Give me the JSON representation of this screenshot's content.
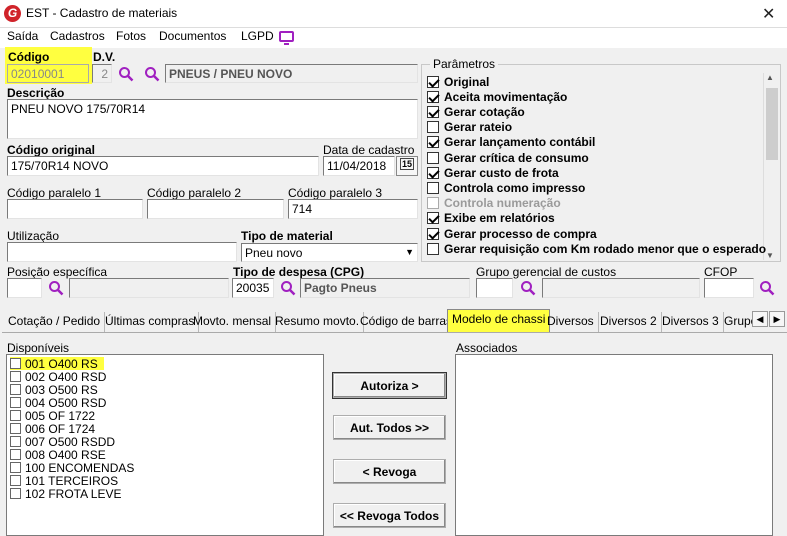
{
  "window": {
    "title": "EST - Cadastro de materiais",
    "logo": "G"
  },
  "menu": [
    "Saída",
    "Cadastros",
    "Fotos",
    "Documentos",
    "LGPD"
  ],
  "form": {
    "codigo_label": "Código",
    "codigo_value": "02010001",
    "dv_label": "D.V.",
    "dv_value": "2",
    "group_value": "PNEUS / PNEU NOVO",
    "descricao_label": "Descrição",
    "descricao_value": "PNEU NOVO 175/70R14",
    "codigo_original_label": "Código original",
    "codigo_original_value": "175/70R14 NOVO",
    "data_cadastro_label": "Data de cadastro",
    "data_cadastro_value": "11/04/2018",
    "calendar_badge": "15",
    "cod_paralelo1_label": "Código paralelo 1",
    "cod_paralelo1_value": "",
    "cod_paralelo2_label": "Código paralelo 2",
    "cod_paralelo2_value": "",
    "cod_paralelo3_label": "Código paralelo 3",
    "cod_paralelo3_value": "714",
    "utilizacao_label": "Utilização",
    "utilizacao_value": "",
    "tipo_material_label": "Tipo de material",
    "tipo_material_value": "Pneu novo",
    "posicao_label": "Posição específica",
    "tipo_despesa_label": "Tipo de despesa (CPG)",
    "tipo_despesa_code": "20035",
    "tipo_despesa_desc": "Pagto Pneus",
    "grupo_gerencial_label": "Grupo gerencial de custos",
    "cfop_label": "CFOP"
  },
  "parametros": {
    "title": "Parâmetros",
    "items": [
      {
        "label": "Original",
        "checked": true,
        "disabled": false
      },
      {
        "label": "Aceita movimentação",
        "checked": true,
        "disabled": false
      },
      {
        "label": "Gerar cotação",
        "checked": true,
        "disabled": false
      },
      {
        "label": "Gerar rateio",
        "checked": false,
        "disabled": false
      },
      {
        "label": "Gerar lançamento contábil",
        "checked": true,
        "disabled": false
      },
      {
        "label": "Gerar crítica de consumo",
        "checked": false,
        "disabled": false
      },
      {
        "label": "Gerar custo de frota",
        "checked": true,
        "disabled": false
      },
      {
        "label": "Controla como impresso",
        "checked": false,
        "disabled": false
      },
      {
        "label": "Controla numeração",
        "checked": false,
        "disabled": true
      },
      {
        "label": "Exibe em relatórios",
        "checked": true,
        "disabled": false
      },
      {
        "label": "Gerar processo de compra",
        "checked": true,
        "disabled": false
      },
      {
        "label": "Gerar requisição com Km rodado menor que o esperado",
        "checked": false,
        "disabled": false
      }
    ]
  },
  "tabs": [
    "Cotação / Pedido",
    "Últimas compras",
    "Movto. mensal",
    "Resumo movto.",
    "Código de barras",
    "Modelo de chassi",
    "Diversos",
    "Diversos 2",
    "Diversos 3",
    "Grupo"
  ],
  "active_tab": "Modelo de chassi",
  "chassi": {
    "disponiveis_label": "Disponíveis",
    "associados_label": "Associados",
    "disponiveis": [
      "001 O400 RS",
      "002 O400 RSD",
      "003 O500 RS",
      "004 O500 RSD",
      "005 OF 1722",
      "006 OF 1724",
      "007 O500 RSDD",
      "008 O400 RSE",
      "100 ENCOMENDAS",
      "101 TERCEIROS",
      "102 FROTA LEVE"
    ],
    "buttons": {
      "autoriza": "Autoriza >",
      "aut_todos": "Aut. Todos >>",
      "revoga": "< Revoga",
      "revoga_todos": "<< Revoga Todos"
    }
  },
  "colors": {
    "highlight": "#ffff40",
    "search_icon": "#a020c0",
    "logo": "#d0232a"
  }
}
